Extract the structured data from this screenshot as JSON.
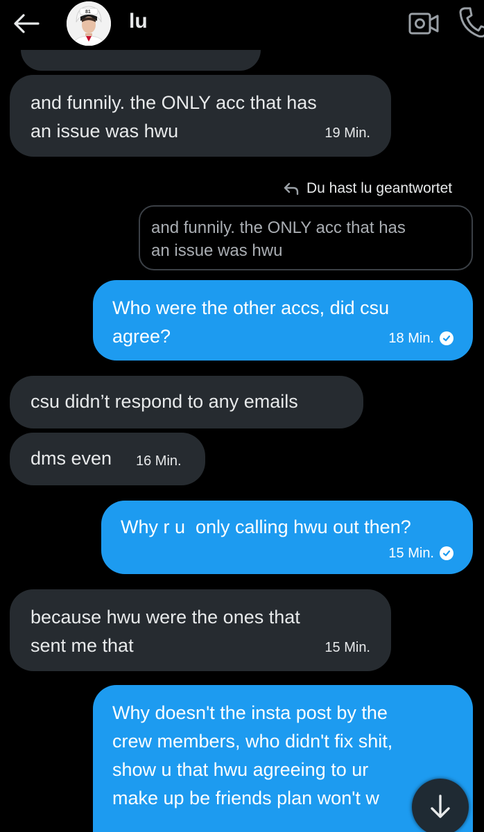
{
  "header": {
    "contact_name": "lu",
    "back_icon": "arrow-left-icon",
    "video_icon": "video-camera-icon",
    "call_icon": "phone-icon"
  },
  "messages": [
    {
      "direction": "in",
      "text": "and funnily. the ONLY acc that has\nan issue was hwu",
      "time": "19 Min."
    },
    {
      "direction": "out",
      "text": "Who were the other accs, did csu\nagree?",
      "time": "18 Min.",
      "read": true
    },
    {
      "direction": "in",
      "text": "csu didn’t respond to any emails",
      "time": ""
    },
    {
      "direction": "in",
      "text": "dms even",
      "time": "16 Min."
    },
    {
      "direction": "out",
      "text": "Why r u  only calling hwu out then?",
      "time": "15 Min.",
      "read": true
    },
    {
      "direction": "in",
      "text": "because hwu were the ones that\nsent me that",
      "time": "15 Min."
    },
    {
      "direction": "out",
      "text": "Why doesn't the insta post by the\ncrew members, who didn't fix shit,\nshow u that hwu agreeing to ur\nmake up be friends plan won't w",
      "time": ""
    }
  ],
  "reply": {
    "note": "Du hast lu geantwortet",
    "quoted_text": "and funnily. the ONLY acc that has\nan issue was hwu"
  },
  "colors": {
    "background": "#000000",
    "incoming_bubble": "#262b30",
    "outgoing_bubble": "#1d9bf0",
    "text": "#e7e9ea"
  },
  "scroll_button_icon": "arrow-down-icon"
}
